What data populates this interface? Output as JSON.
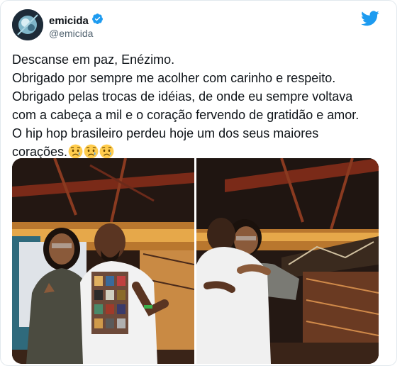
{
  "tweet": {
    "author": {
      "display_name": "emicida",
      "handle": "@emicida",
      "verified": true,
      "avatar": "avatar-photo"
    },
    "lines": [
      "Descanse em paz, Enézimo.",
      "Obrigado por sempre me acolher com carinho e respeito.",
      "Obrigado pelas trocas de idéias, de onde eu sempre voltava",
      "com a cabeça a mil e o coração fervendo de gratidão e amor.",
      "O hip hop brasileiro perdeu hoje um dos seus maiores",
      "corações."
    ],
    "trailing_emoji": [
      "sad-but-relieved-face",
      "sad-but-relieved-face",
      "sad-but-relieved-face"
    ],
    "media": [
      "photo-two-men-posing-with-hand-signs",
      "photo-two-men-hugging"
    ]
  },
  "colors": {
    "twitter_blue": "#1d9bf0",
    "text": "#0f1419",
    "secondary": "#536471",
    "border": "#e1e8ed"
  },
  "icons": [
    "verified-badge-icon",
    "twitter-bird-icon"
  ]
}
